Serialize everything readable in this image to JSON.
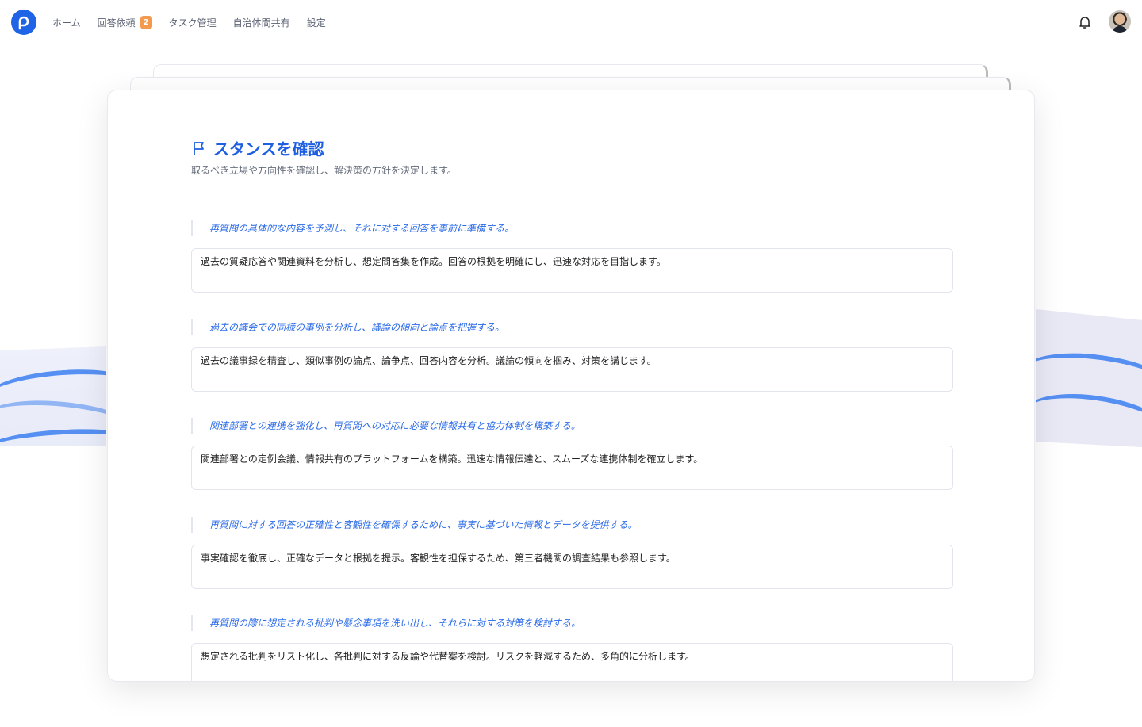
{
  "nav": {
    "items": [
      {
        "label": "ホーム"
      },
      {
        "label": "回答依頼",
        "badge": "2"
      },
      {
        "label": "タスク管理"
      },
      {
        "label": "自治体間共有"
      },
      {
        "label": "設定"
      }
    ]
  },
  "colors": {
    "accent": "#1d5fe0",
    "badge": "#f39a4f"
  },
  "page": {
    "title": "スタンスを確認",
    "subtitle": "取るべき立場や方向性を確認し、解決策の方針を決定します。",
    "items": [
      {
        "heading": "再質問の具体的な内容を予測し、それに対する回答を事前に準備する。",
        "text": "過去の質疑応答や関連資料を分析し、想定問答集を作成。回答の根拠を明確にし、迅速な対応を目指します。"
      },
      {
        "heading": "過去の議会での同様の事例を分析し、議論の傾向と論点を把握する。",
        "text": "過去の議事録を精査し、類似事例の論点、論争点、回答内容を分析。議論の傾向を掴み、対策を講じます。"
      },
      {
        "heading": "関連部署との連携を強化し、再質問への対応に必要な情報共有と協力体制を構築する。",
        "text": "関連部署との定例会議、情報共有のプラットフォームを構築。迅速な情報伝達と、スムーズな連携体制を確立します。"
      },
      {
        "heading": "再質問に対する回答の正確性と客観性を確保するために、事実に基づいた情報とデータを提供する。",
        "text": "事実確認を徹底し、正確なデータと根拠を提示。客観性を担保するため、第三者機関の調査結果も参照します。"
      },
      {
        "heading": "再質問の際に想定される批判や懸念事項を洗い出し、それらに対する対策を検討する。",
        "text": "想定される批判をリスト化し、各批判に対する反論や代替案を検討。リスクを軽減するため、多角的に分析します。"
      }
    ]
  }
}
